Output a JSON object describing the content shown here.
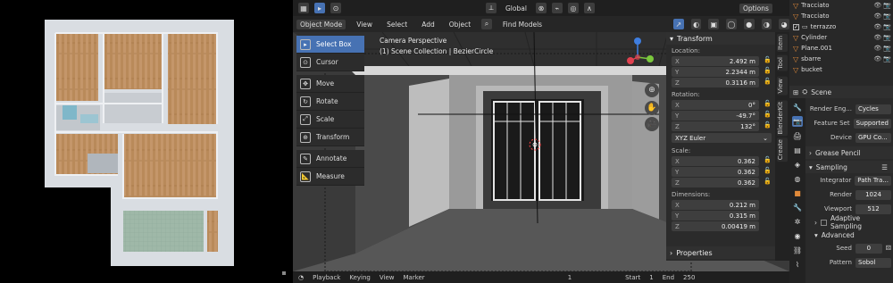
{
  "viewport": {
    "mode": "Object Mode",
    "menus": [
      "View",
      "Select",
      "Add",
      "Object"
    ],
    "find_models": "Find Models",
    "transform_orientation": "Global",
    "options": "Options",
    "camera_label": "Camera Perspective",
    "collection_label": "(1) Scene Collection | BezierCircle"
  },
  "toolbar": {
    "items": [
      "Select Box",
      "Cursor",
      "Move",
      "Rotate",
      "Scale",
      "Transform",
      "Annotate",
      "Measure"
    ]
  },
  "transform": {
    "title": "Transform",
    "location_label": "Location:",
    "location": {
      "x": "2.492 m",
      "y": "2.2344 m",
      "z": "0.3116 m"
    },
    "rotation_label": "Rotation:",
    "rotation": {
      "x": "0°",
      "y": "-49.7°",
      "z": "132°"
    },
    "rotation_mode": "XYZ Euler",
    "scale_label": "Scale:",
    "scale": {
      "x": "0.362",
      "y": "0.362",
      "z": "0.362"
    },
    "dimensions_label": "Dimensions:",
    "dimensions": {
      "x": "0.212 m",
      "y": "0.315 m",
      "z": "0.00419 m"
    },
    "axis_labels": {
      "x": "X",
      "y": "Y",
      "z": "Z"
    },
    "properties": "Properties"
  },
  "side_tabs": [
    "Item",
    "Tool",
    "View",
    "BlenderKit",
    "Create"
  ],
  "timeline": {
    "playback": "Playback",
    "keying": "Keying",
    "view": "View",
    "marker": "Marker",
    "current_frame": "1",
    "start_label": "Start",
    "start": "1",
    "end_label": "End",
    "end": "250"
  },
  "outliner": {
    "items": [
      "Tracciato",
      "Tracciato",
      "terrazzo",
      "Cylinder",
      "Plane.001",
      "sbarre",
      "bucket"
    ]
  },
  "properties": {
    "scene_label": "Scene",
    "render_engine_label": "Render Eng...",
    "render_engine": "Cycles",
    "feature_set_label": "Feature Set",
    "feature_set": "Supported",
    "device_label": "Device",
    "device": "GPU Co...",
    "grease_pencil": "Grease Pencil",
    "sampling": "Sampling",
    "integrator_label": "Integrator",
    "integrator": "Path Tra...",
    "render_label": "Render",
    "render_samples": "1024",
    "viewport_label": "Viewport",
    "viewport_samples": "512",
    "adaptive_sampling": "Adaptive Sampling",
    "advanced": "Advanced",
    "seed_label": "Seed",
    "seed": "0",
    "pattern_label": "Pattern",
    "pattern": "Sobol"
  },
  "colors": {
    "accent": "#4772b3",
    "gizmo_x": "#e0414f",
    "gizmo_y": "#7bc93d",
    "gizmo_z": "#3f7ee0",
    "outliner_object": "#e08a3a"
  }
}
